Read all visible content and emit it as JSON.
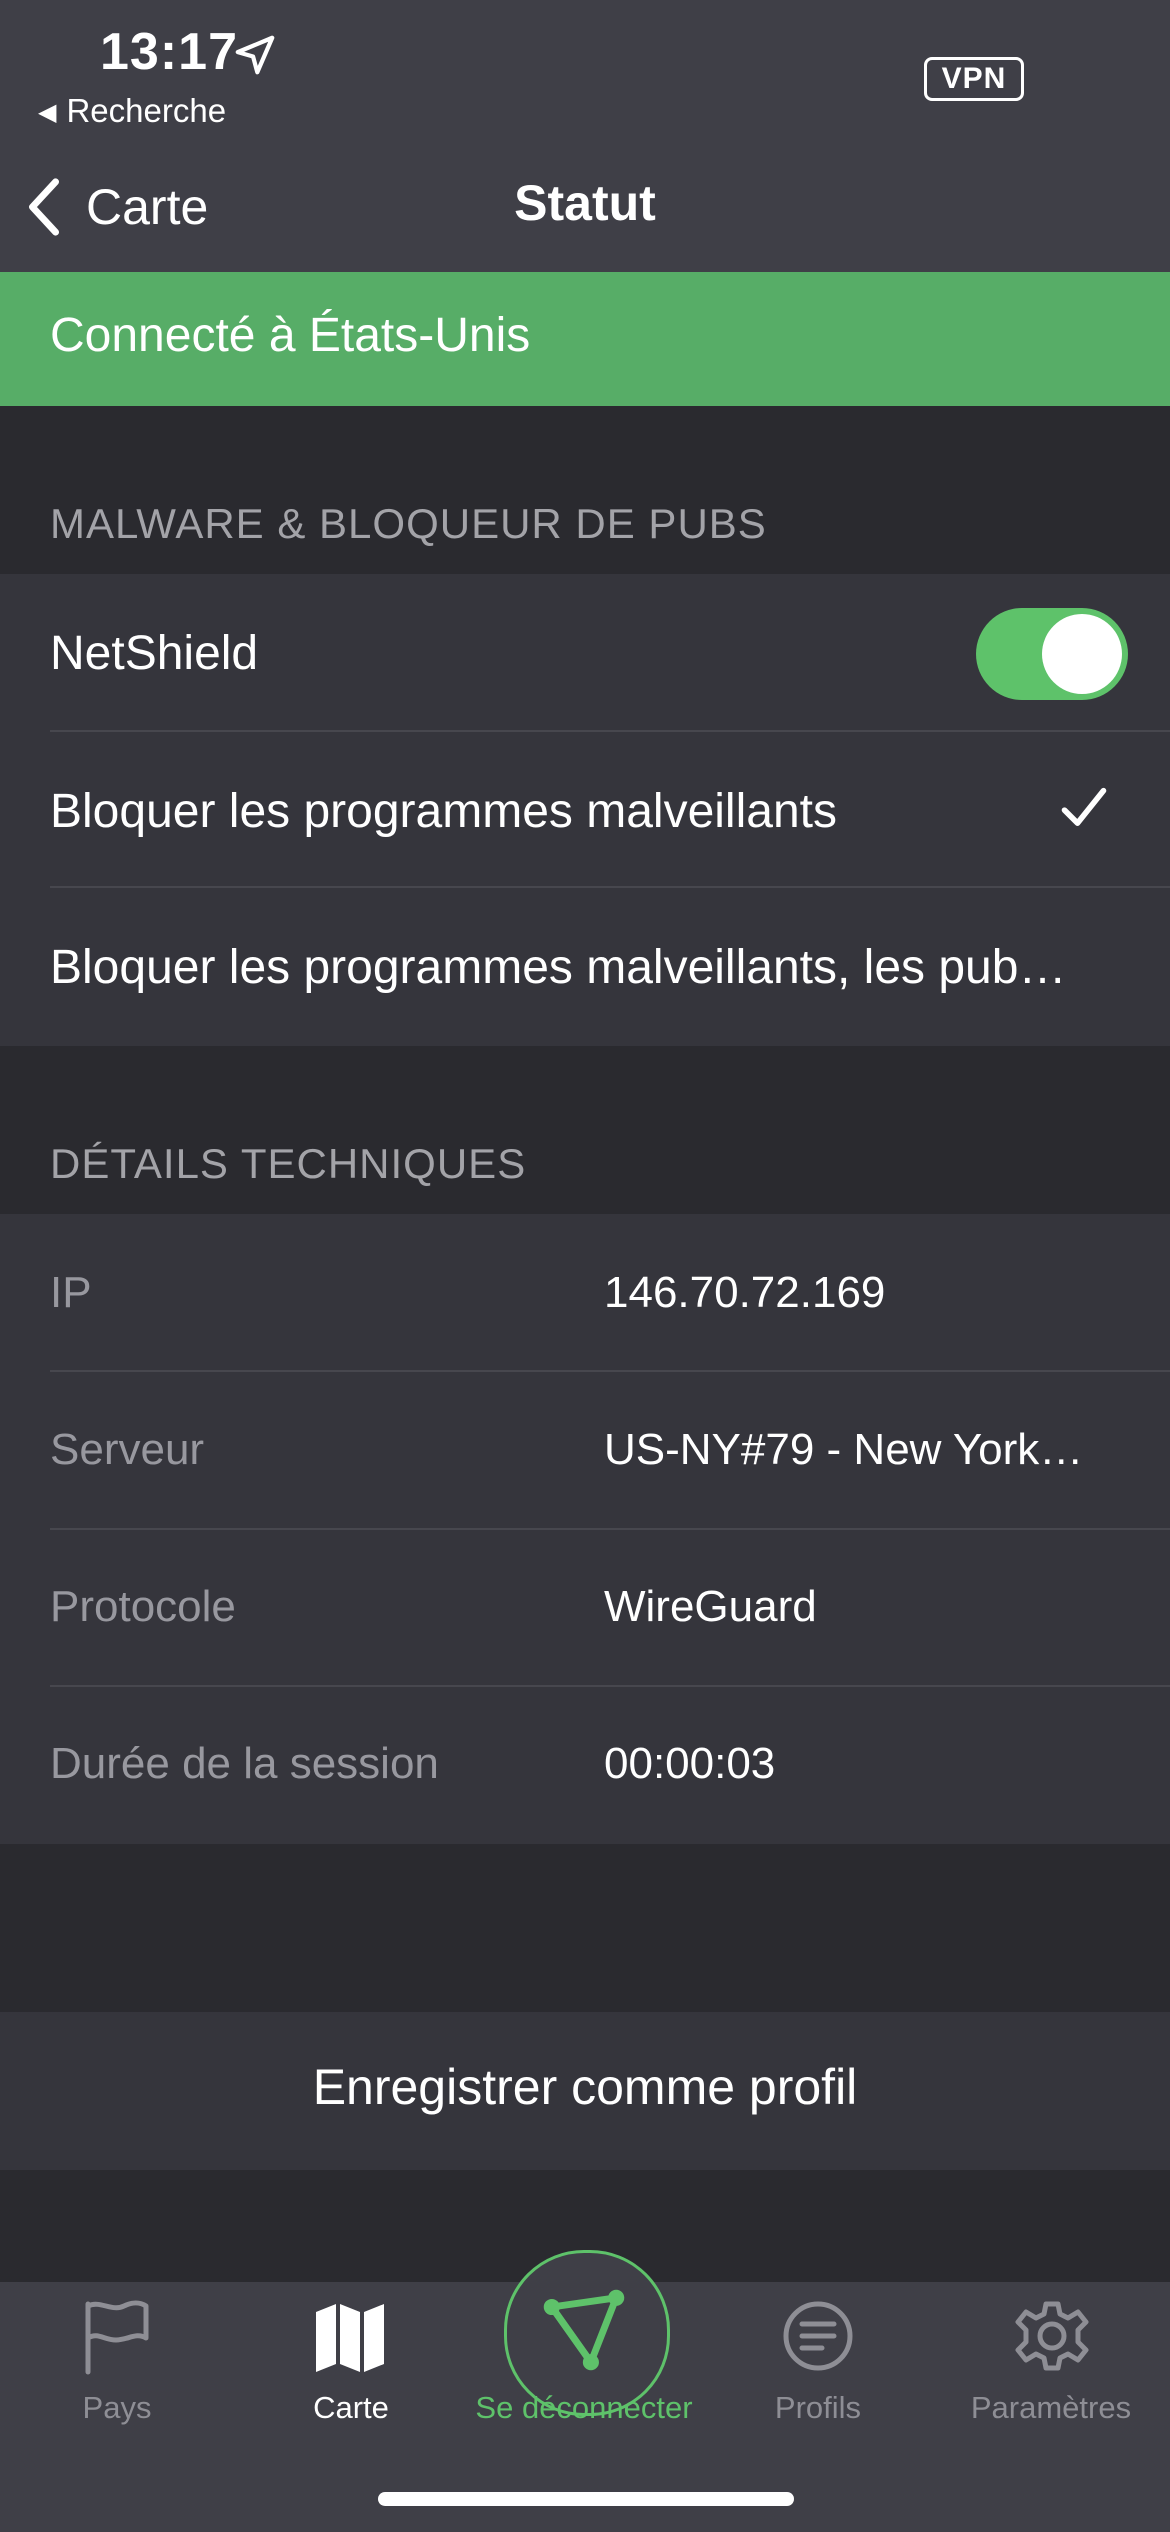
{
  "status_bar": {
    "time": "13:17",
    "back_app": "Recherche",
    "vpn_badge": "VPN"
  },
  "nav": {
    "back_label": "Carte",
    "title": "Statut"
  },
  "connection": {
    "status_text": "Connecté à États-Unis",
    "color": "#57ad67"
  },
  "malware_section": {
    "title": "MALWARE & BLOQUEUR DE PUBS",
    "netshield_label": "NetShield",
    "netshield_enabled": true,
    "options": [
      {
        "label": "Bloquer les programmes malveillants",
        "selected": true
      },
      {
        "label": "Bloquer les programmes malveillants, les pub…",
        "selected": false
      }
    ]
  },
  "tech_section": {
    "title": "DÉTAILS TECHNIQUES",
    "rows": [
      {
        "label": "IP",
        "value": "146.70.72.169"
      },
      {
        "label": "Serveur",
        "value": "US-NY#79 - New York…"
      },
      {
        "label": "Protocole",
        "value": "WireGuard"
      },
      {
        "label": "Durée de la session",
        "value": "00:00:03"
      }
    ]
  },
  "save_profile_label": "Enregistrer comme profil",
  "tabbar": {
    "tabs": [
      {
        "label": "Pays",
        "icon": "flag-icon",
        "active": false
      },
      {
        "label": "Carte",
        "icon": "map-icon",
        "active": true
      },
      {
        "label": "Se déconnecter",
        "icon": "vpn-connect-icon",
        "active": false
      },
      {
        "label": "Profils",
        "icon": "profiles-icon",
        "active": false
      },
      {
        "label": "Paramètres",
        "icon": "gear-icon",
        "active": false
      }
    ]
  },
  "colors": {
    "accent_green": "#5ec26a",
    "header_bg": "#3f3f47",
    "body_bg": "#2a2a2f",
    "row_bg": "#35353c"
  }
}
